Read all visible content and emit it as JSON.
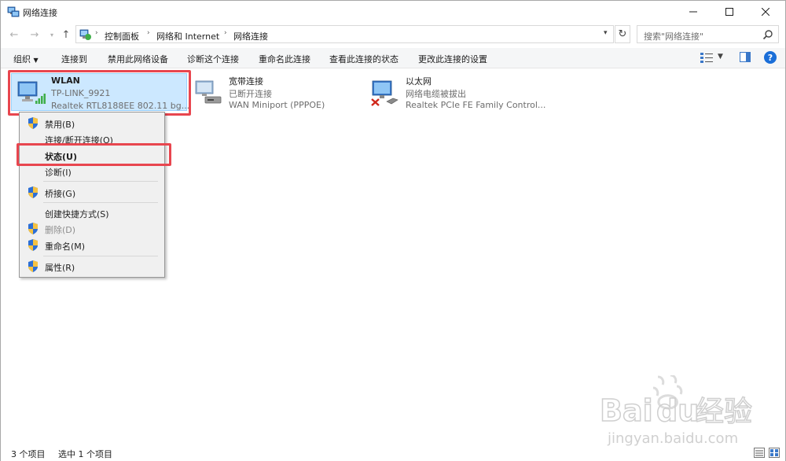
{
  "window": {
    "title": "网络连接",
    "minimize_glyph": "—",
    "maximize_glyph": "☐",
    "close_glyph": "✕"
  },
  "nav": {
    "back": "←",
    "forward": "→",
    "recent": "▾",
    "up": "↑",
    "breadcrumbs": [
      "控制面板",
      "网络和 Internet",
      "网络连接"
    ],
    "breadcrumb_sep": "›",
    "address_dropdown": "▾",
    "refresh": "↻",
    "search_placeholder": "搜索\"网络连接\""
  },
  "toolbar": {
    "organize": "组织",
    "organize_arrow": "▼",
    "connect": "连接到",
    "disable": "禁用此网络设备",
    "diagnose": "诊断这个连接",
    "rename": "重命名此连接",
    "view_status": "查看此连接的状态",
    "change_settings": "更改此连接的设置",
    "view_dropdown": "▼",
    "help": "?"
  },
  "connections": [
    {
      "name": "WLAN",
      "status": "TP-LINK_9921",
      "device": "Realtek RTL8188EE 802.11 bg...",
      "icon": "wifi-network-icon",
      "selected": true
    },
    {
      "name": "宽带连接",
      "status": "已断开连接",
      "device": "WAN Miniport (PPPOE)",
      "icon": "broadband-modem-icon",
      "selected": false
    },
    {
      "name": "以太网",
      "status": "网络电缆被拔出",
      "device": "Realtek PCIe FE Family Control...",
      "icon": "ethernet-disconnected-icon",
      "selected": false
    }
  ],
  "context_menu": {
    "items": [
      {
        "label": "禁用(B)",
        "shield": true,
        "bold": false,
        "disabled": false
      },
      {
        "label": "连接/断开连接(O)",
        "shield": false,
        "bold": false,
        "disabled": false
      },
      {
        "label": "状态(U)",
        "shield": false,
        "bold": true,
        "disabled": false
      },
      {
        "label": "诊断(I)",
        "shield": false,
        "bold": false,
        "disabled": false
      },
      {
        "label": "桥接(G)",
        "shield": true,
        "bold": false,
        "disabled": false
      },
      {
        "label": "创建快捷方式(S)",
        "shield": false,
        "bold": false,
        "disabled": false
      },
      {
        "label": "删除(D)",
        "shield": true,
        "bold": false,
        "disabled": true
      },
      {
        "label": "重命名(M)",
        "shield": true,
        "bold": false,
        "disabled": false
      },
      {
        "label": "属性(R)",
        "shield": true,
        "bold": false,
        "disabled": false
      }
    ]
  },
  "statusbar": {
    "item_count": "3 个项目",
    "selected_count": "选中 1 个项目"
  },
  "colors": {
    "accent": "#1a6ed8",
    "selection": "#cce8ff",
    "annotation": "#e8464f"
  }
}
